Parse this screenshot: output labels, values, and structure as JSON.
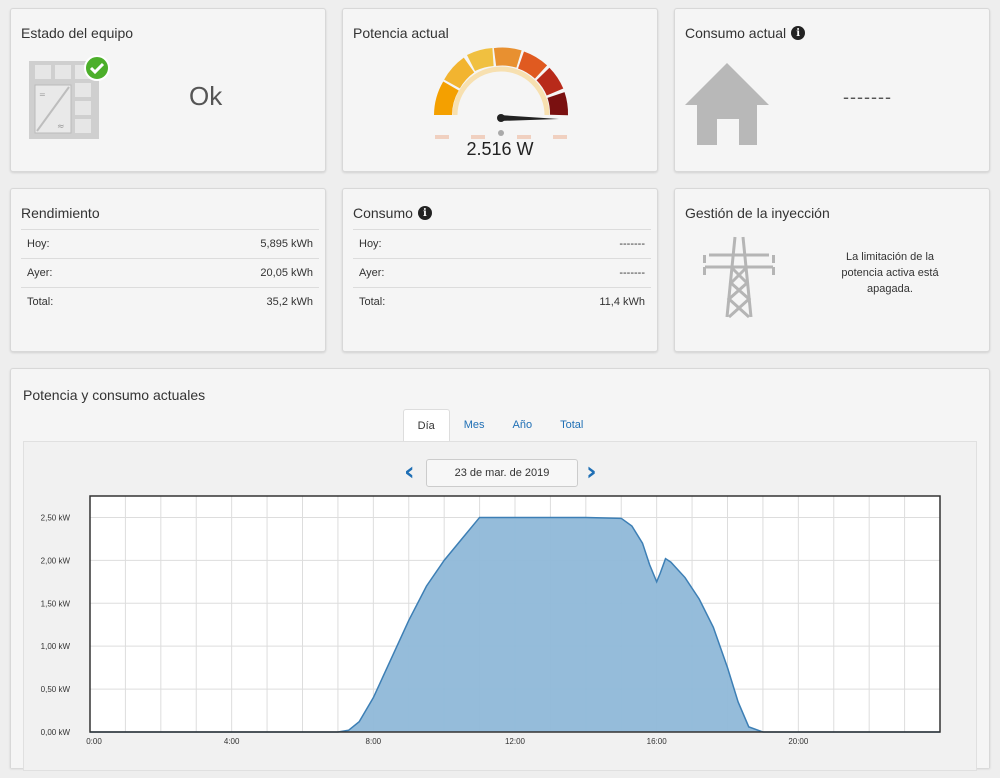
{
  "status": {
    "title": "Estado del equipo",
    "value": "Ok"
  },
  "power": {
    "title": "Potencia actual",
    "value": "2.516 W"
  },
  "consumption_now": {
    "title": "Consumo actual",
    "value": "-------"
  },
  "yield": {
    "title": "Rendimiento",
    "rows": [
      {
        "label": "Hoy:",
        "value": "5,895 kWh"
      },
      {
        "label": "Ayer:",
        "value": "20,05 kWh"
      },
      {
        "label": "Total:",
        "value": "35,2 kWh"
      }
    ]
  },
  "consumption": {
    "title": "Consumo",
    "rows": [
      {
        "label": "Hoy:",
        "value": "-------"
      },
      {
        "label": "Ayer:",
        "value": "-------"
      },
      {
        "label": "Total:",
        "value": "11,4 kWh"
      }
    ]
  },
  "injection": {
    "title": "Gestión de la inyección",
    "text": "La limitación de la potencia activa está apagada."
  },
  "chart_card": {
    "title": "Potencia y consumo actuales",
    "tabs": [
      "Día",
      "Mes",
      "Año",
      "Total"
    ],
    "active_tab": "Día",
    "date": "23 de mar. de 2019",
    "prev_icon": "chevron-left-icon",
    "next_icon": "chevron-right-icon"
  },
  "colors": {
    "fill": "#8fb8d8",
    "line": "#3d7fb5",
    "accent": "#1f6fb5"
  },
  "chart_data": {
    "type": "area",
    "yticks": [
      "0,00 kW",
      "0,50 kW",
      "1,00 kW",
      "1,50 kW",
      "2,00 kW",
      "2,50 kW"
    ],
    "xticks": [
      "0:00",
      "4:00",
      "8:00",
      "12:00",
      "16:00",
      "20:00"
    ],
    "xlim": [
      0,
      24
    ],
    "ylim": [
      0,
      2.75
    ],
    "grid": true,
    "series": [
      {
        "values": [
          [
            0,
            0
          ],
          [
            7,
            0
          ],
          [
            7.3,
            0.02
          ],
          [
            7.6,
            0.12
          ],
          [
            8,
            0.4
          ],
          [
            8.5,
            0.85
          ],
          [
            9,
            1.3
          ],
          [
            9.5,
            1.7
          ],
          [
            10,
            2.0
          ],
          [
            10.5,
            2.25
          ],
          [
            11,
            2.5
          ],
          [
            11.5,
            2.5
          ],
          [
            12,
            2.5
          ],
          [
            13,
            2.5
          ],
          [
            14,
            2.5
          ],
          [
            15,
            2.49
          ],
          [
            15.3,
            2.4
          ],
          [
            15.6,
            2.2
          ],
          [
            15.8,
            1.95
          ],
          [
            16,
            1.75
          ],
          [
            16.1,
            1.85
          ],
          [
            16.25,
            2.02
          ],
          [
            16.4,
            1.98
          ],
          [
            16.8,
            1.8
          ],
          [
            17.2,
            1.55
          ],
          [
            17.6,
            1.22
          ],
          [
            18,
            0.75
          ],
          [
            18.3,
            0.35
          ],
          [
            18.6,
            0.06
          ],
          [
            19,
            0
          ],
          [
            24,
            0
          ]
        ]
      }
    ]
  }
}
